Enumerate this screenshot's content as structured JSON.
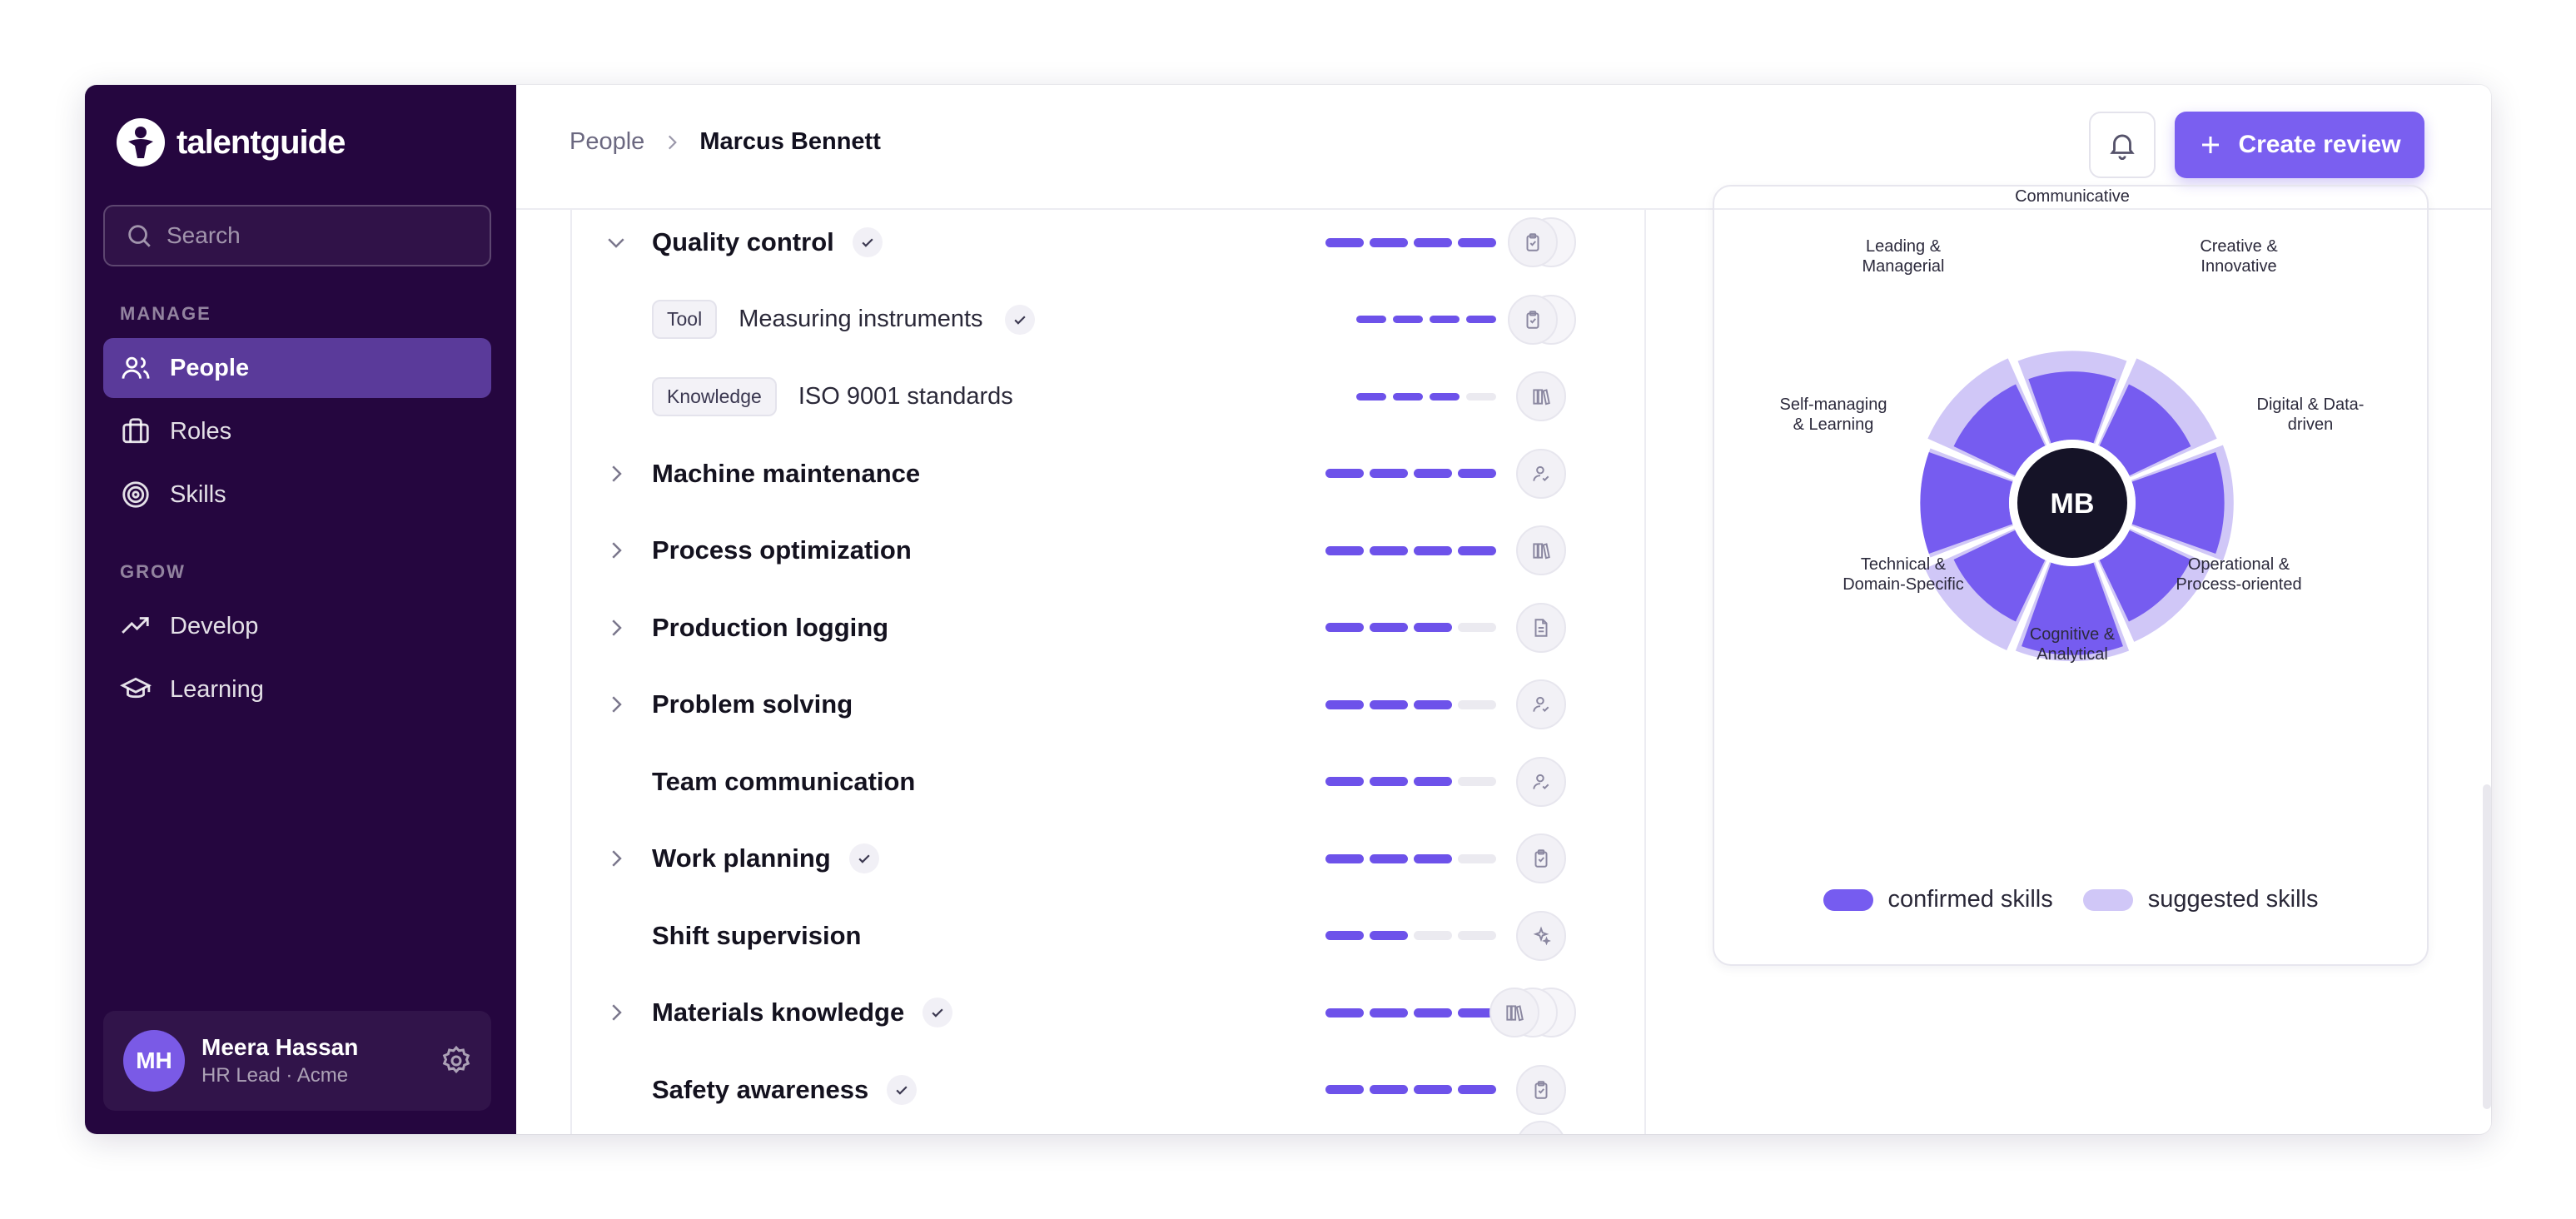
{
  "brand": {
    "name": "talentguide"
  },
  "sidebar": {
    "search_placeholder": "Search",
    "sections": [
      {
        "label": "MANAGE",
        "items": [
          {
            "label": "People",
            "icon": "users-icon",
            "active": true
          },
          {
            "label": "Roles",
            "icon": "briefcase-icon",
            "active": false
          },
          {
            "label": "Skills",
            "icon": "target-icon",
            "active": false
          }
        ]
      },
      {
        "label": "GROW",
        "items": [
          {
            "label": "Develop",
            "icon": "trending-up-icon",
            "active": false
          },
          {
            "label": "Learning",
            "icon": "graduation-cap-icon",
            "active": false
          }
        ]
      }
    ],
    "user": {
      "initials": "MH",
      "name": "Meera Hassan",
      "role": "HR Lead · Acme"
    }
  },
  "header": {
    "breadcrumb": {
      "root": "People",
      "current": "Marcus Bennett"
    },
    "create_label": "Create review"
  },
  "skills": [
    {
      "name": "Quality control",
      "verified": true,
      "expanded": true,
      "level": 4,
      "evidence": "clipboard-icon",
      "stacked": true
    },
    {
      "name": "Measuring instruments",
      "tag": "Tool",
      "verified": true,
      "child": true,
      "level": 4,
      "evidence": "clipboard-icon",
      "stacked": true
    },
    {
      "name": "ISO 9001 standards",
      "tag": "Knowledge",
      "verified": false,
      "child": true,
      "level": 3,
      "evidence": "books-icon"
    },
    {
      "name": "Machine maintenance",
      "verified": false,
      "expandable": true,
      "level": 4,
      "evidence": "user-check-icon"
    },
    {
      "name": "Process optimization",
      "verified": false,
      "expandable": true,
      "level": 4,
      "evidence": "books-icon"
    },
    {
      "name": "Production logging",
      "verified": false,
      "expandable": true,
      "level": 3,
      "evidence": "document-icon"
    },
    {
      "name": "Problem solving",
      "verified": false,
      "expandable": true,
      "level": 3,
      "evidence": "user-check-icon"
    },
    {
      "name": "Team communication",
      "verified": false,
      "expandable": false,
      "level": 3,
      "evidence": "user-check-icon"
    },
    {
      "name": "Work planning",
      "verified": true,
      "expandable": true,
      "level": 3,
      "evidence": "clipboard-icon"
    },
    {
      "name": "Shift supervision",
      "verified": false,
      "expandable": false,
      "level": 2,
      "evidence": "sparkles-icon"
    },
    {
      "name": "Materials knowledge",
      "verified": true,
      "expandable": true,
      "level": 4,
      "evidence": "books-icon",
      "stacked3": true
    },
    {
      "name": "Safety awareness",
      "verified": true,
      "expandable": false,
      "level": 4,
      "evidence": "clipboard-icon"
    }
  ],
  "radar": {
    "center": "MB",
    "labels": [
      "Communicative",
      "Creative & Innovative",
      "Digital & Data-driven",
      "Operational & Process-oriented",
      "Cognitive & Analytical",
      "Technical & Domain-Specific",
      "Self-managing & Learning",
      "Leading & Managerial"
    ],
    "label_lines": [
      [
        "Communicative"
      ],
      [
        "Creative &",
        "Innovative"
      ],
      [
        "Digital & Data-",
        "driven"
      ],
      [
        "Operational &",
        "Process-oriented"
      ],
      [
        "Cognitive &",
        "Analytical"
      ],
      [
        "Technical &",
        "Domain-Specific"
      ],
      [
        "Self-managing",
        "& Learning"
      ],
      [
        "Leading &",
        "Managerial"
      ]
    ],
    "confirmed": [
      0.66,
      0.66,
      0.86,
      0.66,
      0.86,
      0.66,
      0.86,
      0.66
    ],
    "suggested": [
      0.86,
      0.92,
      0.95,
      0.86,
      0.92,
      0.95,
      0.86,
      0.92
    ],
    "legend": {
      "confirmed": "confirmed skills",
      "suggested": "suggested skills"
    },
    "colors": {
      "confirmed": "#765cf0",
      "suggested": "#d0c7f7",
      "center": "#151327"
    }
  }
}
